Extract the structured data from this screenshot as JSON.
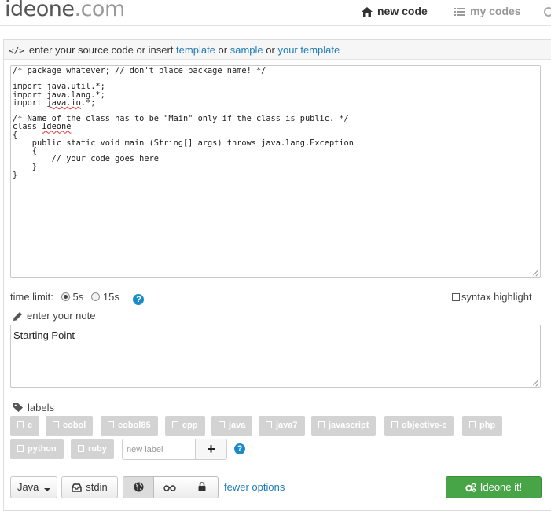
{
  "header": {
    "logo_main": "ideone",
    "logo_tld": ".com",
    "nav_new_code": "new code",
    "nav_my_codes": "my codes"
  },
  "source_header": {
    "prefix": "enter your source code or insert",
    "template_link": "template",
    "or1": "or",
    "sample_link": "sample",
    "or2": "or",
    "your_template_link": "your template"
  },
  "editor": {
    "code": "/* package whatever; // don't place package name! */\n\nimport java.util.*;\nimport java.lang.*;\nimport java.io.*;\n\n/* Name of the class has to be \"Main\" only if the class is public. */\nclass Ideone\n{\n    public static void main (String[] args) throws java.lang.Exception\n    {\n        // your code goes here\n    }\n}"
  },
  "options": {
    "time_limit_label": "time limit:",
    "time_5s": "5s",
    "time_15s": "15s",
    "help": "?",
    "syntax_highlight": "syntax highlight"
  },
  "note": {
    "title": "enter your note",
    "value": "Starting Point"
  },
  "labels": {
    "title": "labels",
    "tags": [
      "c",
      "cobol",
      "cobol85",
      "cpp",
      "java",
      "java7",
      "javascript",
      "objective-c",
      "php",
      "python",
      "ruby"
    ],
    "new_label_placeholder": "new label",
    "add": "+"
  },
  "footer": {
    "language": "Java",
    "stdin": "stdin",
    "fewer_options": "fewer options",
    "submit": "Ideone it!"
  },
  "colors": {
    "link": "#1e7bb8",
    "submit_green": "#47a447",
    "tag_gray": "#d3d3d3"
  }
}
